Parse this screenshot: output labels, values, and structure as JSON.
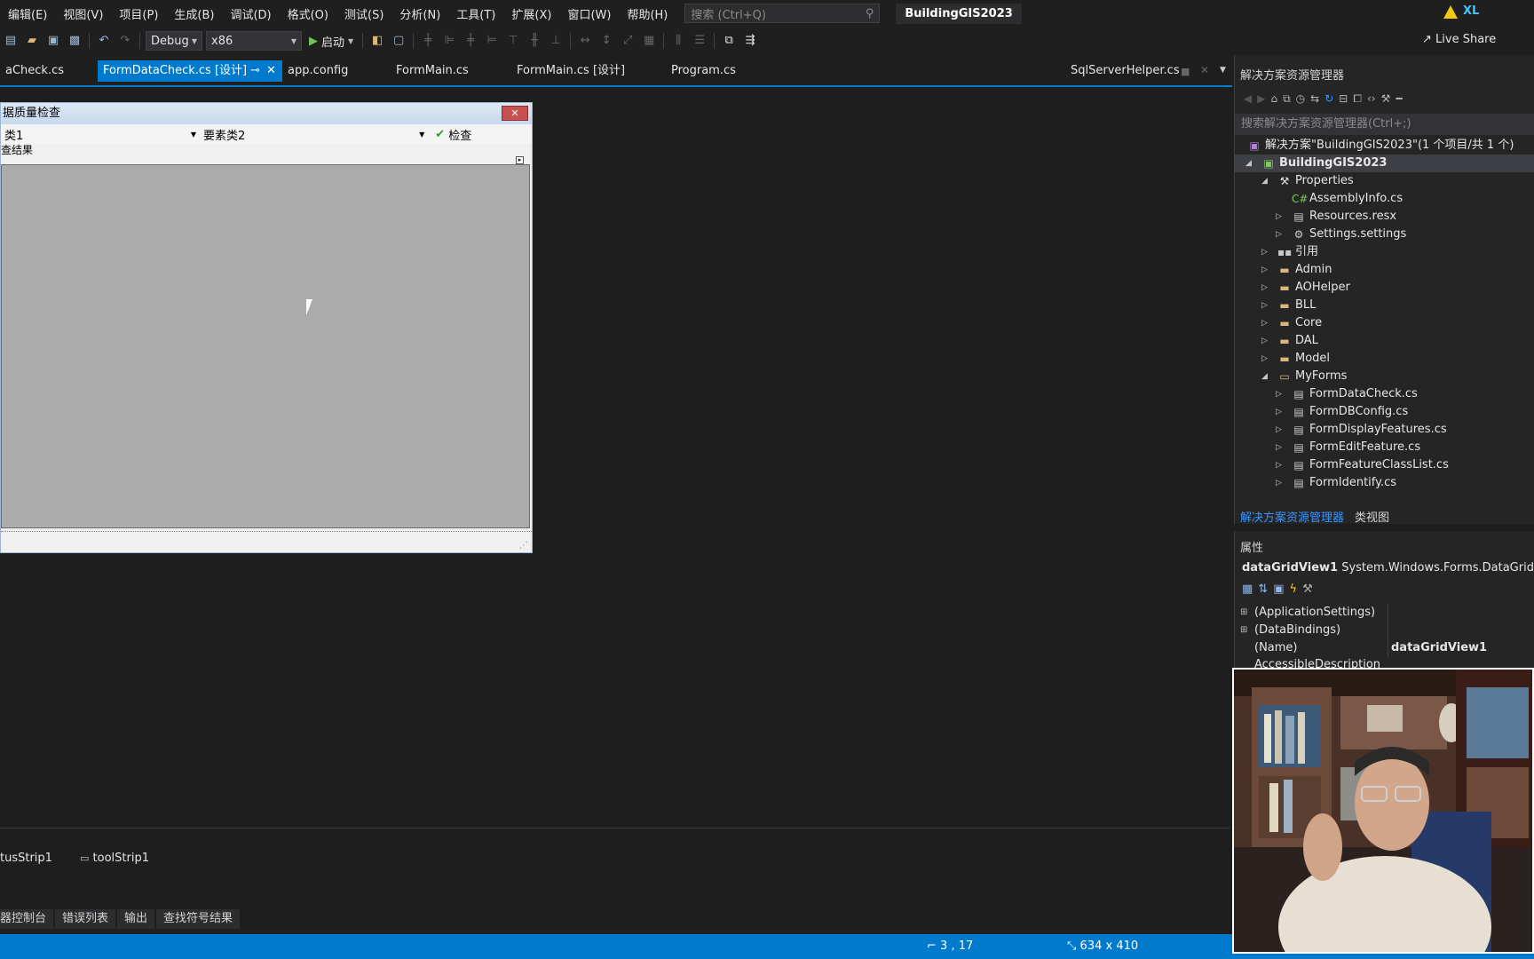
{
  "menu": {
    "items": [
      "编辑(E)",
      "视图(V)",
      "项目(P)",
      "生成(B)",
      "调试(D)",
      "格式(O)",
      "测试(S)",
      "分析(N)",
      "工具(T)",
      "扩展(X)",
      "窗口(W)",
      "帮助(H)"
    ],
    "search_placeholder": "搜索 (Ctrl+Q)",
    "app_title": "BuildingGIS2023",
    "user_initials": "XL"
  },
  "toolbar": {
    "config": "Debug",
    "platform": "x86",
    "start_label": "启动",
    "live_share": "Live Share"
  },
  "tabs": [
    {
      "label": "aCheck.cs"
    },
    {
      "label": "FormDataCheck.cs [设计]",
      "active": true
    },
    {
      "label": "app.config"
    },
    {
      "label": "FormMain.cs"
    },
    {
      "label": "FormMain.cs [设计]"
    },
    {
      "label": "Program.cs"
    },
    {
      "label": "SqlServerHelper.cs"
    }
  ],
  "designer": {
    "form_title": "据质量检查",
    "combo1_value": "类1",
    "label2": "要素类2",
    "check_button": "检查",
    "groupbox_label": "查结果"
  },
  "tray": {
    "items": [
      "tusStrip1",
      "toolStrip1"
    ]
  },
  "bottom_tabs": [
    "器控制台",
    "错误列表",
    "输出",
    "查找符号结果"
  ],
  "status": {
    "position": "3 , 17",
    "size": "634 x 410"
  },
  "solution_explorer": {
    "title": "解决方案资源管理器",
    "search_placeholder": "搜索解决方案资源管理器(Ctrl+;)",
    "solution_label": "解决方案\"BuildingGIS2023\"(1 个项目/共 1 个)",
    "project": "BuildingGIS2023",
    "nodes": {
      "properties": "Properties",
      "assemblyinfo": "AssemblyInfo.cs",
      "resources": "Resources.resx",
      "settings": "Settings.settings",
      "refs": "引用",
      "admin": "Admin",
      "aohelper": "AOHelper",
      "bll": "BLL",
      "core": "Core",
      "dal": "DAL",
      "model": "Model",
      "myforms": "MyForms",
      "f1": "FormDataCheck.cs",
      "f2": "FormDBConfig.cs",
      "f3": "FormDisplayFeatures.cs",
      "f4": "FormEditFeature.cs",
      "f5": "FormFeatureClassList.cs",
      "f6": "FormIdentify.cs"
    },
    "tab_active": "解决方案资源管理器",
    "tab_class": "类视图"
  },
  "properties_panel": {
    "title": "属性",
    "object_name": "dataGridView1",
    "object_type": "System.Windows.Forms.DataGridView",
    "rows": [
      {
        "name": "(ApplicationSettings)",
        "value": ""
      },
      {
        "name": "(DataBindings)",
        "value": ""
      },
      {
        "name": "(Name)",
        "value": "dataGridView1"
      },
      {
        "name": "AccessibleDescription",
        "value": ""
      }
    ]
  }
}
